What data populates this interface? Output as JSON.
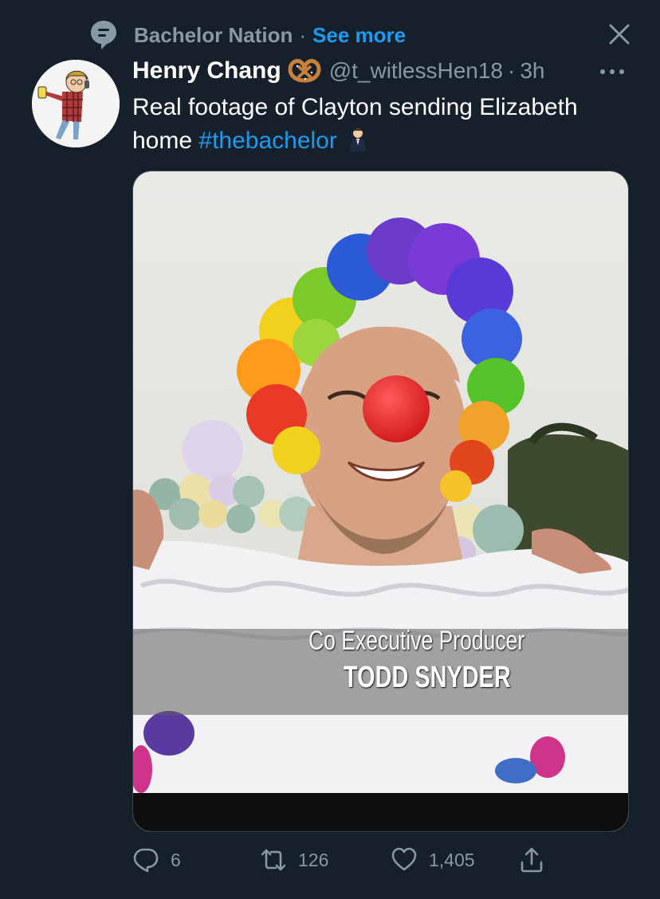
{
  "social_context": {
    "icon": "topic-icon",
    "label": "Bachelor Nation",
    "separator": "·",
    "see_more": "See more"
  },
  "header": {
    "author_name": "Henry Chang",
    "author_badge_icon": "pretzel-emoji",
    "handle": "@t_witlessHen18",
    "separator": "·",
    "time": "3h"
  },
  "tweet": {
    "text": "Real footage of Clayton sending Elizabeth home ",
    "hashtag": "#thebachelor",
    "trailing_emoji": "man-in-tuxedo-emoji"
  },
  "media": {
    "description_icon": "photo",
    "overlay_line1": "Co Executive Producer",
    "overlay_line2": "TODD SNYDER"
  },
  "actions": {
    "reply_count": "6",
    "retweet_count": "126",
    "like_count": "1,405"
  },
  "colors": {
    "background": "#15202b",
    "secondary_text": "#8899a6",
    "accent": "#1d9bf0"
  }
}
